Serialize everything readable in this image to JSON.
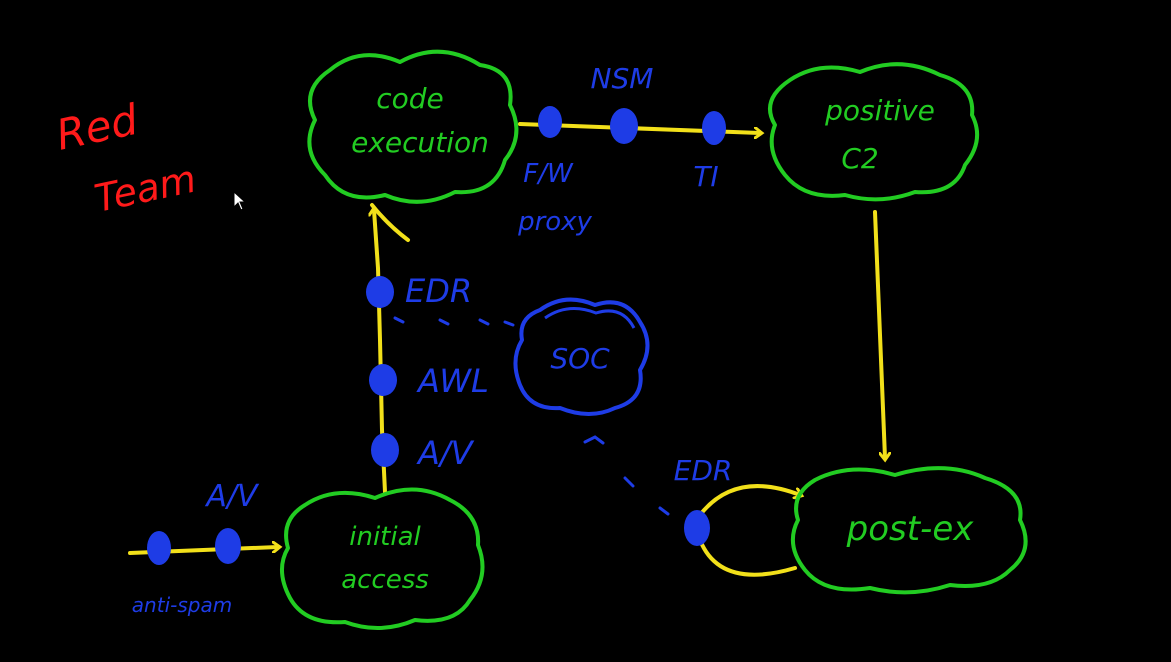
{
  "colors": {
    "background": "#000000",
    "title": "#ff1a1a",
    "node_outline": "#22cc22",
    "node_text": "#22cc22",
    "arrow": "#f2e01a",
    "control": "#1e3ce6"
  },
  "title": {
    "line1": "Red",
    "line2": "Team"
  },
  "nodes": {
    "code_execution": {
      "line1": "code",
      "line2": "execution"
    },
    "positive_c2": {
      "line1": "positive",
      "line2": "C2"
    },
    "initial_access": {
      "line1": "initial",
      "line2": "access"
    },
    "post_ex": {
      "line1": "post-ex"
    }
  },
  "controls": {
    "anti_spam": "anti-spam",
    "av_entry": "A/V",
    "edr_vertical": "EDR",
    "awl": "AWL",
    "av_vertical": "A/V",
    "nsm": "NSM",
    "fw_proxy": {
      "line1": "F/W",
      "line2": "proxy"
    },
    "ti": "TI",
    "soc": "SOC",
    "edr_post": "EDR"
  },
  "icons": {
    "cursor": "mouse-pointer-icon"
  }
}
